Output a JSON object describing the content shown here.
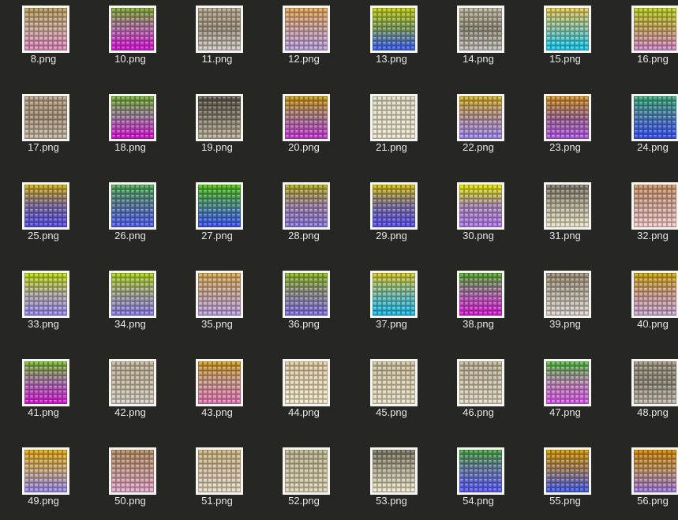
{
  "files": [
    {
      "name": "8.png",
      "top": "#b59a62",
      "mid": "#c8a999",
      "bot": "#d98ab8"
    },
    {
      "name": "10.png",
      "top": "#7fa03a",
      "mid": "#b06fa6",
      "bot": "#d21ccf"
    },
    {
      "name": "11.png",
      "top": "#b0a28a",
      "mid": "#9a917e",
      "bot": "#c9c2ba"
    },
    {
      "name": "12.png",
      "top": "#d9a35c",
      "mid": "#c8a0a0",
      "bot": "#b9a0d8"
    },
    {
      "name": "13.png",
      "top": "#b6c31a",
      "mid": "#7a9a60",
      "bot": "#3f62e6"
    },
    {
      "name": "14.png",
      "top": "#b5ad96",
      "mid": "#8d8978",
      "bot": "#bdb8b2"
    },
    {
      "name": "15.png",
      "top": "#d8c35a",
      "mid": "#8ac0a8",
      "bot": "#22c8e8"
    },
    {
      "name": "16.png",
      "top": "#b6c82a",
      "mid": "#c0a060",
      "bot": "#d08ac0"
    },
    {
      "name": "17.png",
      "top": "#b29c82",
      "mid": "#a5937d",
      "bot": "#c2b3a0"
    },
    {
      "name": "18.png",
      "top": "#6fa43a",
      "mid": "#9c7a9e",
      "bot": "#d21ccf"
    },
    {
      "name": "19.png",
      "top": "#5b5449",
      "mid": "#837a6a",
      "bot": "#b5ac98"
    },
    {
      "name": "20.png",
      "top": "#c0901e",
      "mid": "#a67a88",
      "bot": "#c43ed0"
    },
    {
      "name": "21.png",
      "top": "#d9d6bb",
      "mid": "#e2dcc4",
      "bot": "#e7e1cb"
    },
    {
      "name": "22.png",
      "top": "#c9a630",
      "mid": "#b09090",
      "bot": "#a18ae6"
    },
    {
      "name": "23.png",
      "top": "#c78a2a",
      "mid": "#9b6a8a",
      "bot": "#b05be0"
    },
    {
      "name": "24.png",
      "top": "#3aa07a",
      "mid": "#4f7ab0",
      "bot": "#3a56f0"
    },
    {
      "name": "25.png",
      "top": "#c0a220",
      "mid": "#7a6a9a",
      "bot": "#5a50e0"
    },
    {
      "name": "26.png",
      "top": "#4fa05a",
      "mid": "#58789a",
      "bot": "#5260e8"
    },
    {
      "name": "27.png",
      "top": "#4fb41e",
      "mid": "#4e8a88",
      "bot": "#3f58ea"
    },
    {
      "name": "28.png",
      "top": "#a8a02a",
      "mid": "#9a80a0",
      "bot": "#8e78d8"
    },
    {
      "name": "29.png",
      "top": "#c4b11a",
      "mid": "#7a7098",
      "bot": "#5a50e6"
    },
    {
      "name": "30.png",
      "top": "#d6d80e",
      "mid": "#a88ab0",
      "bot": "#b07ae8"
    },
    {
      "name": "31.png",
      "top": "#7a7566",
      "mid": "#b2ad96",
      "bot": "#e4dfc2"
    },
    {
      "name": "32.png",
      "top": "#c4926a",
      "mid": "#d0a69a",
      "bot": "#eec6c4"
    },
    {
      "name": "33.png",
      "top": "#b6d21a",
      "mid": "#b0a8a0",
      "bot": "#9a8ae6"
    },
    {
      "name": "34.png",
      "top": "#a8c82a",
      "mid": "#a0a090",
      "bot": "#8a80e0"
    },
    {
      "name": "35.png",
      "top": "#d2a65a",
      "mid": "#c0a49a",
      "bot": "#b9a0d6"
    },
    {
      "name": "36.png",
      "top": "#8aae2a",
      "mid": "#8a8a8c",
      "bot": "#8272d8"
    },
    {
      "name": "37.png",
      "top": "#c8c034",
      "mid": "#78b8a8",
      "bot": "#22b8e0"
    },
    {
      "name": "38.png",
      "top": "#5aa03a",
      "mid": "#a86aa8",
      "bot": "#d222cf"
    },
    {
      "name": "39.png",
      "top": "#9a8c74",
      "mid": "#b8b0a2",
      "bot": "#d6d0c8"
    },
    {
      "name": "40.png",
      "top": "#c8a01e",
      "mid": "#c89a8c",
      "bot": "#c8a6c8"
    },
    {
      "name": "41.png",
      "top": "#7aae3a",
      "mid": "#a470a6",
      "bot": "#d022cf"
    },
    {
      "name": "42.png",
      "top": "#bfb096",
      "mid": "#c2b8a4",
      "bot": "#d2ccc0"
    },
    {
      "name": "43.png",
      "top": "#c8962e",
      "mid": "#c89a8e",
      "bot": "#e07ab0"
    },
    {
      "name": "44.png",
      "top": "#d8c6a0",
      "mid": "#e2d4b6",
      "bot": "#ece2c8"
    },
    {
      "name": "45.png",
      "top": "#c8bc9a",
      "mid": "#d6ccae",
      "bot": "#e4dcc2"
    },
    {
      "name": "46.png",
      "top": "#bab094",
      "mid": "#cac0a8",
      "bot": "#dcd4c0"
    },
    {
      "name": "47.png",
      "top": "#5aae4a",
      "mid": "#b68ab0",
      "bot": "#d45ce0"
    },
    {
      "name": "48.png",
      "top": "#9a917c",
      "mid": "#8a8576",
      "bot": "#b9b3a6"
    },
    {
      "name": "49.png",
      "top": "#d4a21e",
      "mid": "#c6a880",
      "bot": "#9a8ae0"
    },
    {
      "name": "50.png",
      "top": "#b08a64",
      "mid": "#c49a92",
      "bot": "#e0a6c6"
    },
    {
      "name": "51.png",
      "top": "#c8b080",
      "mid": "#d0bea2",
      "bot": "#e2d6c0"
    },
    {
      "name": "52.png",
      "top": "#b8b090",
      "mid": "#c8c0a0",
      "bot": "#d8d0b2"
    },
    {
      "name": "53.png",
      "top": "#7a7464",
      "mid": "#b4ae96",
      "bot": "#e6e0c6"
    },
    {
      "name": "54.png",
      "top": "#4a9a4a",
      "mid": "#6a78a8",
      "bot": "#5a5ef0"
    },
    {
      "name": "55.png",
      "top": "#c8920e",
      "mid": "#9a7c6a",
      "bot": "#4a5ee0"
    },
    {
      "name": "56.png",
      "top": "#c88210",
      "mid": "#b8906a",
      "bot": "#a07ad0"
    }
  ]
}
